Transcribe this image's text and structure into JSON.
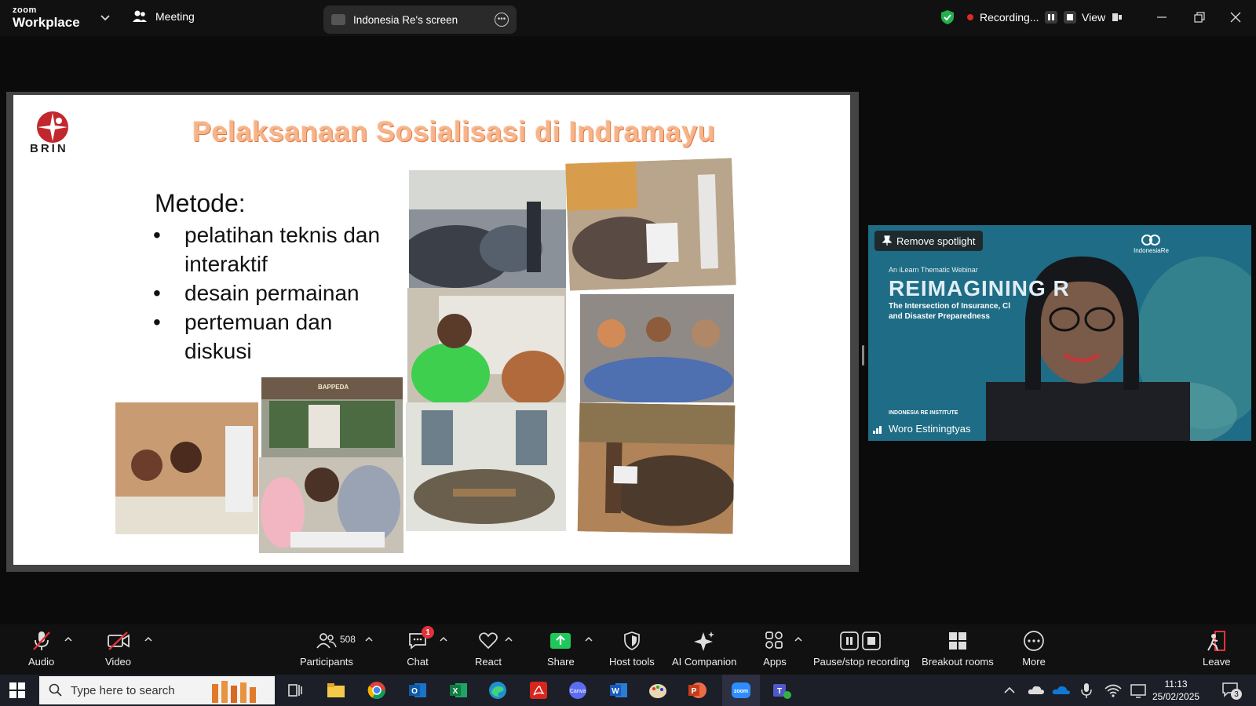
{
  "app": {
    "brand_small": "zoom",
    "brand_name": "Workplace",
    "meeting_label": "Meeting",
    "shared_screen_label": "Indonesia Re's screen",
    "recording_label": "Recording...",
    "view_label": "View"
  },
  "slide": {
    "logo_text": "BRIN",
    "title": "Pelaksanaan Sosialisasi di Indramayu",
    "method_heading": "Metode:",
    "method_items": [
      "pelatihan teknis dan interaktif",
      "desain permainan",
      "pertemuan dan diskusi"
    ],
    "photo_label_bappeda": "BAPPEDA"
  },
  "speaker": {
    "spotlight_button": "Remove spotlight",
    "webinar_subtitle": "An iLearn Thematic Webinar",
    "webinar_title": "REIMAGINING R",
    "webinar_line1": "The Intersection of Insurance, Cl",
    "webinar_line2": "and Disaster Preparedness",
    "org_logo": "IndonesiaRe",
    "footer_logo": "INDONESIA RE INSTITUTE",
    "name": "Woro Estiningtyas"
  },
  "toolbar": {
    "audio": "Audio",
    "video": "Video",
    "participants": "Participants",
    "participants_count": "508",
    "chat": "Chat",
    "chat_badge": "1",
    "react": "React",
    "share": "Share",
    "host_tools": "Host tools",
    "ai_companion": "AI Companion",
    "apps": "Apps",
    "pause_stop_recording": "Pause/stop recording",
    "breakout_rooms": "Breakout rooms",
    "more": "More",
    "leave": "Leave"
  },
  "taskbar": {
    "search_placeholder": "Type here to search",
    "time": "11:13",
    "date": "25/02/2025",
    "notification_count": "3"
  },
  "colors": {
    "title_orange": "#f7b48a",
    "share_green": "#1fc85a",
    "leave_red": "#e0323a",
    "recording_red": "#e02828",
    "shield_green": "#22b14c"
  }
}
